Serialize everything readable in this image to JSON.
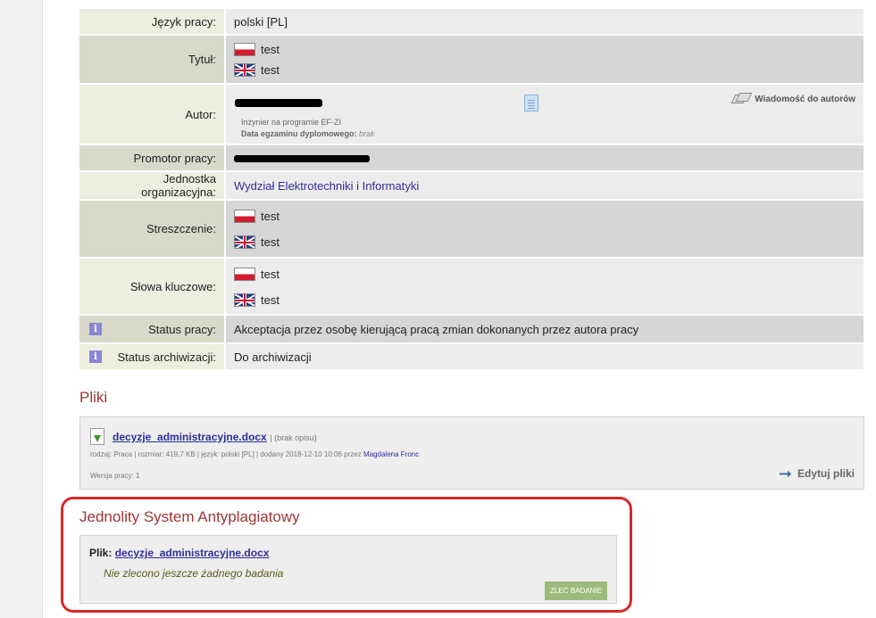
{
  "rows": {
    "jezyk": {
      "label": "Język pracy:",
      "value": "polski [PL]"
    },
    "tytul": {
      "label": "Tytuł:",
      "pl": "test",
      "en": "test"
    },
    "autor": {
      "label": "Autor:",
      "program": "Inżynier na programie EF-ZI",
      "exam_label": "Data egzaminu dyplomowego:",
      "exam_value": "brak",
      "message_button": "Wiadomość do autorów"
    },
    "promotor": {
      "label": "Promotor pracy:"
    },
    "jednostka": {
      "label": "Jednostka organizacyjna:",
      "value": "Wydział Elektrotechniki i Informatyki"
    },
    "streszczenie": {
      "label": "Streszczenie:",
      "pl": "test",
      "en": "test"
    },
    "slowa": {
      "label": "Słowa kluczowe:",
      "pl": "test",
      "en": "test"
    },
    "status_pracy": {
      "label": "Status pracy:",
      "value": "Akceptacja przez osobę kierującą pracą zmian dokonanych przez autora pracy"
    },
    "status_arch": {
      "label": "Status archiwizacji:",
      "value": "Do archiwizacji"
    }
  },
  "files": {
    "heading": "Pliki",
    "file_name": "decyzje_administracyjne.docx",
    "no_desc": "| (brak opisu)",
    "meta_prefix": "rodzaj: Praca | rozmiar: 419,7 KB | język: polski [PL] | dodany 2018-12-10 10:06 przez",
    "added_by": "Magdalena Fronc",
    "version": "Wersja pracy: 1",
    "edit_label": "Edytuj pliki"
  },
  "jsa": {
    "heading": "Jednolity System Antyplagiatowy",
    "file_label": "Plik:",
    "file_name": "decyzje_administracyjne.docx",
    "no_test": "Nie zlecono jeszcze żadnego badania",
    "button": "ZLEĆ BADANIE"
  }
}
